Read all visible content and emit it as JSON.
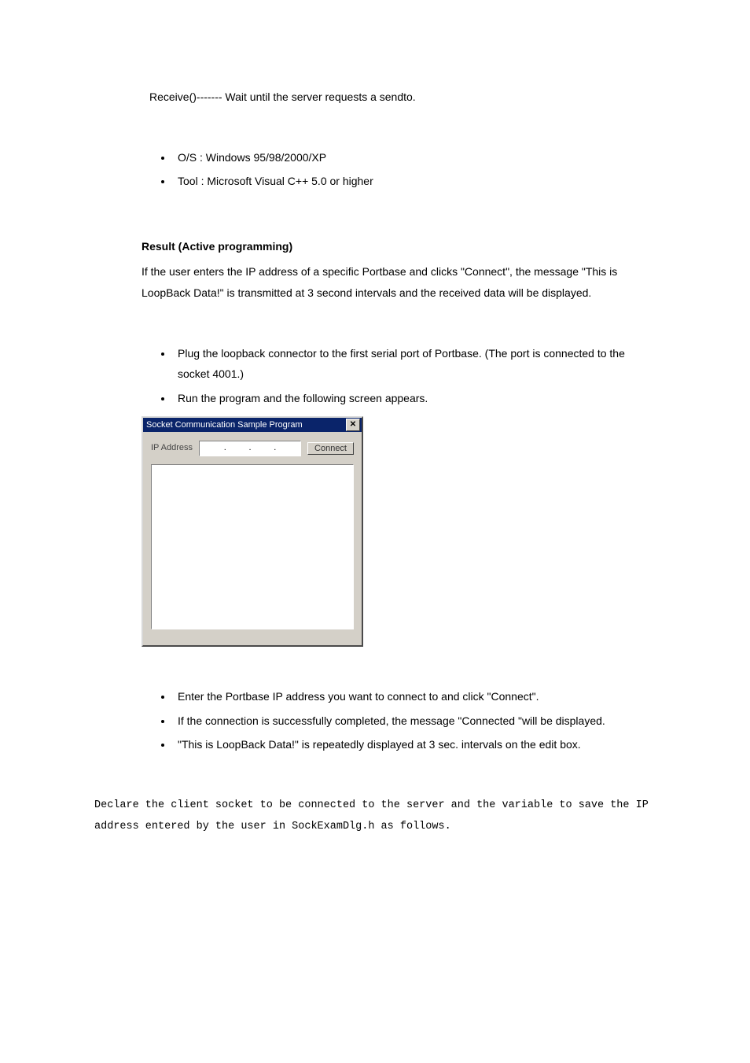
{
  "intro_line": "Receive()------- Wait until the server requests a sendto.",
  "env": {
    "items": [
      "O/S : Windows 95/98/2000/XP",
      "Tool : Microsoft Visual C++ 5.0 or higher"
    ]
  },
  "result": {
    "heading": "Result (Active programming)",
    "desc": "If the user enters the IP address of a specific Portbase and clicks \"Connect\", the message \"This is LoopBack Data!\" is transmitted at 3 second intervals and the received data will be displayed.",
    "steps_before": [
      "Plug the loopback connector to the first serial port of Portbase. (The port is connected to the socket 4001.)",
      "Run the program and the following screen appears."
    ]
  },
  "dialog": {
    "title": "Socket Communication Sample Program",
    "ip_label": "IP Address",
    "connect_label": "Connect",
    "close_glyph": "✕"
  },
  "steps_after": [
    "Enter the Portbase IP address you want to connect to and click \"Connect\".",
    "If the connection is successfully completed, the message \"Connected \"will be displayed.",
    "\"This is LoopBack Data!\" is repeatedly displayed at 3 sec. intervals on the edit box."
  ],
  "mono_text": "Declare the client socket to be connected to the server and the variable to save the IP address entered by the user in SockExamDlg.h as follows."
}
